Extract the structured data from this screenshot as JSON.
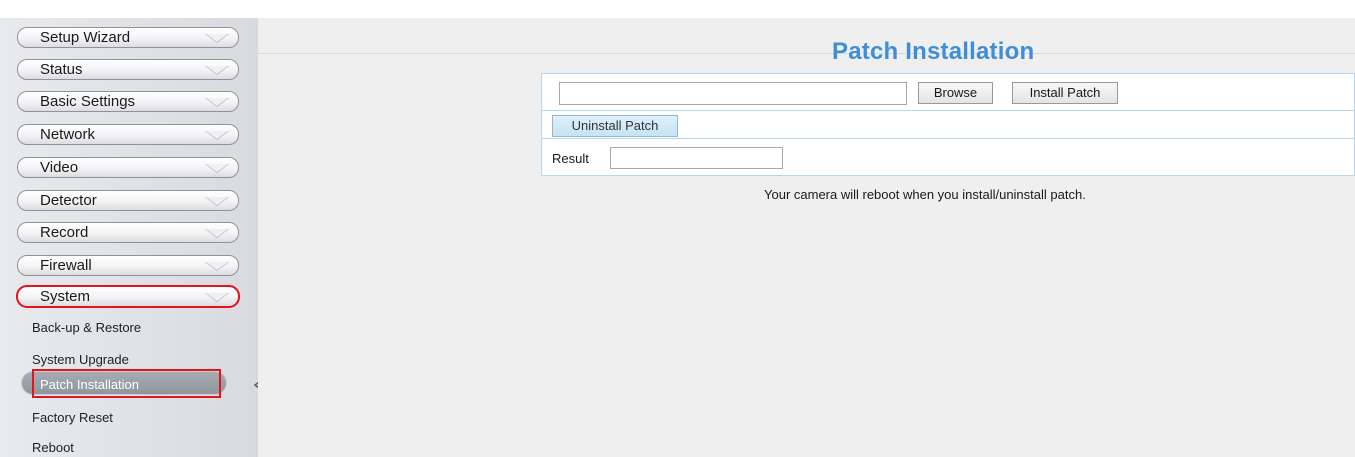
{
  "sidebar": {
    "menu": [
      {
        "label": "Setup Wizard"
      },
      {
        "label": "Status"
      },
      {
        "label": "Basic Settings"
      },
      {
        "label": "Network"
      },
      {
        "label": "Video"
      },
      {
        "label": "Detector"
      },
      {
        "label": "Record"
      },
      {
        "label": "Firewall"
      },
      {
        "label": "System",
        "selected": true
      }
    ],
    "submenu": [
      {
        "label": "Back-up & Restore"
      },
      {
        "label": "System Upgrade"
      },
      {
        "label": "Patch Installation",
        "active": true
      },
      {
        "label": "Factory Reset"
      },
      {
        "label": "Reboot"
      }
    ]
  },
  "main": {
    "title": "Patch Installation",
    "file_input": {
      "value": ""
    },
    "browse_label": "Browse",
    "install_label": "Install Patch",
    "uninstall_label": "Uninstall Patch",
    "result_label": "Result",
    "result_value": "",
    "notice": "Your camera will reboot when you install/uninstall patch."
  },
  "colors": {
    "title": "#3f8ed6",
    "highlight_box": "#e0161c",
    "panel_border": "#b9d6ec"
  },
  "icons": {
    "menu_arrow": "chevron-down-icon",
    "pointer": "pointer-arrow-icon"
  }
}
